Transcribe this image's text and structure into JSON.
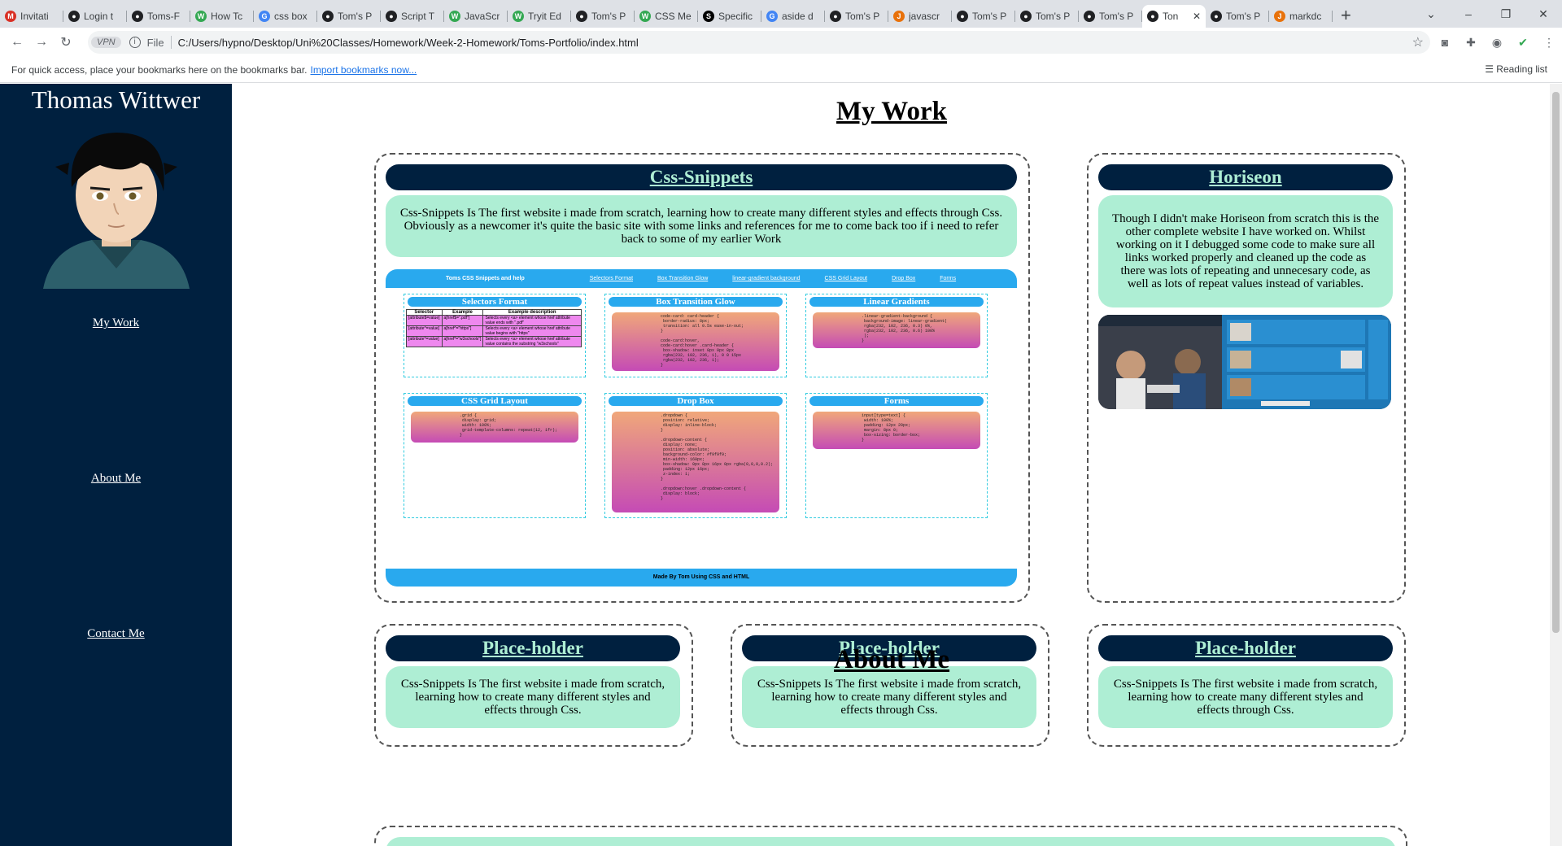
{
  "browser": {
    "tabs": [
      {
        "title": "Invitati",
        "icon": "gmail-icon",
        "color": "#d93025",
        "glyph": "M"
      },
      {
        "title": "Login t",
        "icon": "github-icon",
        "color": "#202124",
        "glyph": "●"
      },
      {
        "title": "Toms-F",
        "icon": "github-icon",
        "color": "#202124",
        "glyph": "●"
      },
      {
        "title": "How Tc",
        "icon": "wikihow-icon",
        "color": "#34a853",
        "glyph": "W"
      },
      {
        "title": "css box",
        "icon": "google-icon",
        "color": "#4285f4",
        "glyph": "G"
      },
      {
        "title": "Tom's P",
        "icon": "globe-icon",
        "color": "#202124",
        "glyph": "●"
      },
      {
        "title": "Script T",
        "icon": "globe-icon",
        "color": "#202124",
        "glyph": "●"
      },
      {
        "title": "JavaScr",
        "icon": "wikihow-icon",
        "color": "#34a853",
        "glyph": "W"
      },
      {
        "title": "Tryit Ed",
        "icon": "wikihow-icon",
        "color": "#34a853",
        "glyph": "W"
      },
      {
        "title": "Tom's P",
        "icon": "globe-icon",
        "color": "#202124",
        "glyph": "●"
      },
      {
        "title": "CSS Me",
        "icon": "wikihow-icon",
        "color": "#34a853",
        "glyph": "W"
      },
      {
        "title": "Specific",
        "icon": "stackoverflow-icon",
        "color": "#000000",
        "glyph": "S"
      },
      {
        "title": "aside d",
        "icon": "google-icon",
        "color": "#4285f4",
        "glyph": "G"
      },
      {
        "title": "Tom's P",
        "icon": "globe-icon",
        "color": "#202124",
        "glyph": "●"
      },
      {
        "title": "javascr",
        "icon": "slides-icon",
        "color": "#e8710a",
        "glyph": "J"
      },
      {
        "title": "Tom's P",
        "icon": "globe-icon",
        "color": "#202124",
        "glyph": "●"
      },
      {
        "title": "Tom's P",
        "icon": "globe-icon",
        "color": "#202124",
        "glyph": "●"
      },
      {
        "title": "Tom's P",
        "icon": "globe-icon",
        "color": "#202124",
        "glyph": "●"
      },
      {
        "title": "Ton",
        "icon": "globe-icon",
        "color": "#202124",
        "glyph": "●",
        "active": true
      },
      {
        "title": "Tom's P",
        "icon": "globe-icon",
        "color": "#202124",
        "glyph": "●"
      },
      {
        "title": "markdc",
        "icon": "slides-icon",
        "color": "#e8710a",
        "glyph": "J"
      }
    ],
    "new_tab": "+",
    "url_badge": "VPN",
    "url_scheme": "File",
    "url": "C:/Users/hypno/Desktop/Uni%20Classes/Homework/Week-2-Homework/Toms-Portfolio/index.html",
    "bookmarks_text": "For quick access, place your bookmarks here on the bookmarks bar.",
    "bookmarks_link": "Import bookmarks now...",
    "reading_list": "Reading list"
  },
  "sidebar": {
    "name": "Thomas Wittwer",
    "links": [
      {
        "label": "My Work"
      },
      {
        "label": "About Me"
      },
      {
        "label": "Contact Me"
      }
    ]
  },
  "main": {
    "my_work_heading": "My Work",
    "about_heading": "About Me",
    "cards": [
      {
        "title": "Css-Snippets",
        "text": "Css-Snippets Is The first website i made from scratch, learning how to create many different styles and effects through Css. Obviously as a newcomer it's quite the basic site with some links and references for me to come back too if i need to refer back to some of my earlier Work"
      },
      {
        "title": "Horiseon",
        "text": "Though I didn't make Horiseon from scratch this is the other complete website I have worked on. Whilst working on it I debugged some code to make sure all links worked properly and cleaned up the code as there was lots of repeating and unnecesary code, as well as lots of repeat values instead of variables."
      },
      {
        "title": "Place-holder",
        "text": "Css-Snippets Is The first website i made from scratch, learning how to create many different styles and effects through Css."
      },
      {
        "title": "Place-holder",
        "text": "Css-Snippets Is The first website i made from scratch, learning how to create many different styles and effects through Css."
      },
      {
        "title": "Place-holder",
        "text": "Css-Snippets Is The first website i made from scratch, learning how to create many different styles and effects through Css."
      }
    ],
    "preview": {
      "brand": "Toms CSS Snippets and help",
      "nav": [
        "Selectors Format",
        "Box Transition Glow",
        "linear-gradient background",
        "CSS Grid Layout",
        "Drop Box",
        "Forms"
      ],
      "footer": "Made By Tom Using CSS and HTML",
      "boxes": [
        {
          "title": "Selectors Format"
        },
        {
          "title": "Box Transition Glow",
          "code": "code-card: card-header {\n border-radius: 8px;\n transition: all 0.5s ease-in-out;\n}\n\ncode-card:hover,\ncode-card:hover .card-header {\n box-shadow: inset 0px 0px 8px\n rgba(232, 102, 236, 1), 0 0 15px\n rgba(232, 102, 236, 1);\n}"
        },
        {
          "title": "Linear Gradients",
          "code": ".linear-gradient-background {\n background-image: linear-gradient(\n rgba(232, 102, 236, 0.3) 0%,\n rgba(232, 102, 236, 0.6) 100%\n );\n}"
        },
        {
          "title": "CSS Grid Layout",
          "code": ".grid {\n display: grid;\n width: 100%;\n grid-template-columns: repeat(12, 1fr);\n}"
        },
        {
          "title": "Drop Box",
          "code": ".dropdown {\n position: relative;\n display: inline-block;\n}\n\n.dropdown-content {\n display: none;\n position: absolute;\n background-color: #f9f9f9;\n min-width: 160px;\n box-shadow: 0px 8px 16px 0px rgba(0,0,0,0.2);\n padding: 12px 16px;\n z-index: 1;\n}\n\n.dropdown:hover .dropdown-content {\n display: block;\n}"
        },
        {
          "title": "Forms",
          "code": "input[type=text] {\n width: 100%;\n padding: 12px 20px;\n margin: 8px 0;\n box-sizing: border-box;\n}"
        }
      ],
      "table": {
        "headers": [
          "Selector",
          "Example",
          "Example description"
        ],
        "rows": [
          [
            "[attribute$=value]",
            "a[href$=\".pdf\"]",
            "Selects every <a> element whose href attribute value ends with \".pdf\""
          ],
          [
            "[attribute^=value]",
            "a[href^=\"https\"]",
            "Selects every <a> element whose href attribute value begins with \"https\""
          ],
          [
            "[attribute*=value]",
            "a[href*=\"w3schools\"]",
            "Selects every <a> element whose href attribute value contains the substring \"w3schools\""
          ]
        ]
      }
    }
  },
  "colors": {
    "sidebar_bg": "#00203f",
    "card_text_bg": "#aeeed4",
    "accent_blue": "#29a9ee"
  }
}
